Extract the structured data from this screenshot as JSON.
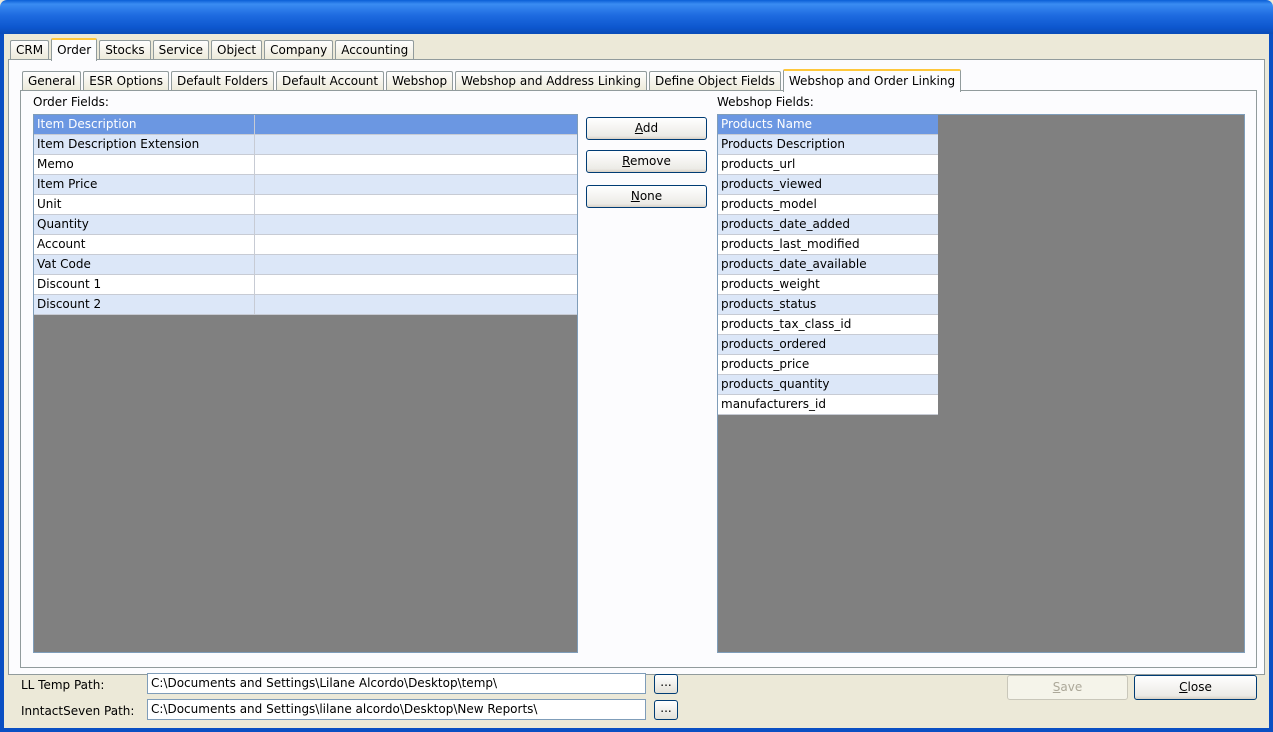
{
  "main_tabs": [
    "CRM",
    "Order",
    "Stocks",
    "Service",
    "Object",
    "Company",
    "Accounting"
  ],
  "sub_tabs": [
    "General",
    "ESR Options",
    "Default Folders",
    "Default Account",
    "Webshop",
    "Webshop and Address Linking",
    "Define Object Fields",
    "Webshop and Order Linking"
  ],
  "order_fields": {
    "label": "Order Fields:",
    "rows": [
      "Item Description",
      "Item Description Extension",
      "Memo",
      "Item Price",
      "Unit",
      "Quantity",
      "Account",
      "Vat Code",
      "Discount 1",
      "Discount 2"
    ]
  },
  "webshop_fields": {
    "label": "Webshop Fields:",
    "rows": [
      "Products Name",
      "Products Description",
      "products_url",
      "products_viewed",
      "products_model",
      "products_date_added",
      "products_last_modified",
      "products_date_available",
      "products_weight",
      "products_status",
      "products_tax_class_id",
      "products_ordered",
      "products_price",
      "products_quantity",
      "manufacturers_id"
    ]
  },
  "actions": {
    "add_underline": "A",
    "add_rest": "dd",
    "remove_underline": "R",
    "remove_rest": "emove",
    "none_underline": "N",
    "none_rest": "one"
  },
  "paths": {
    "ll_temp_label": "LL Temp Path:",
    "ll_temp_value": "C:\\Documents and Settings\\Lilane Alcordo\\Desktop\\temp\\",
    "inntact_label": "InntactSeven Path:",
    "inntact_value": "C:\\Documents and Settings\\lilane alcordo\\Desktop\\New Reports\\",
    "browse_label": "..."
  },
  "footer": {
    "save_underline": "S",
    "save_rest": "ave",
    "close_underline": "C",
    "close_rest": "lose"
  }
}
